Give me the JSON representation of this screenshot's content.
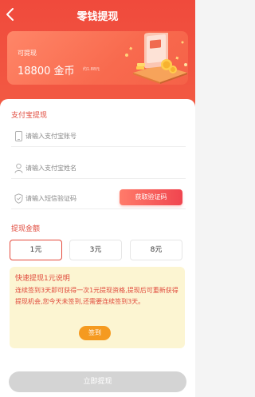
{
  "nav": {
    "title": "零钱提现"
  },
  "card": {
    "label": "可提现",
    "amount": "18800 金币",
    "approx": "约1.88元"
  },
  "alipay": {
    "title": "支付宝提现",
    "account_placeholder": "请输入支付宝账号",
    "name_placeholder": "请输入支付宝姓名",
    "code_placeholder": "请输入短信验证码",
    "code_button": "获取验证码"
  },
  "amount": {
    "title": "提现金额",
    "options": [
      "1元",
      "3元",
      "8元"
    ],
    "selected": "1元"
  },
  "tip": {
    "title": "快速提现1元说明",
    "body": "连续签到3天即可获得一次1元提现资格,提现后可重新获得提现机会,您今天未签到,还需要连续签到3天。",
    "button": "签到"
  },
  "submit": {
    "label": "立即提现"
  },
  "colors": {
    "brand": "#f04a3c",
    "tip_bg": "#fcf5d2",
    "sign_btn": "#f59a20",
    "disabled": "#d4d4d4"
  }
}
